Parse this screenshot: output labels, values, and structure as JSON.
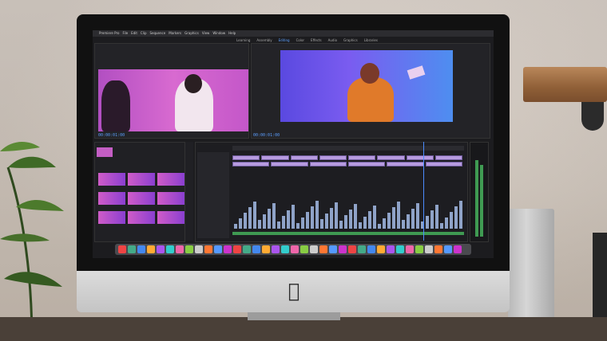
{
  "menubar": {
    "items": [
      "Premiere Pro",
      "File",
      "Edit",
      "Clip",
      "Sequence",
      "Markers",
      "Graphics",
      "View",
      "Window",
      "Help"
    ]
  },
  "workspaces": [
    "Learning",
    "Assembly",
    "Editing",
    "Color",
    "Effects",
    "Audio",
    "Graphics",
    "Libraries"
  ],
  "source_monitor": {
    "timecode": "00:00:01:00"
  },
  "program_monitor": {
    "timecode": "00:00:01:00"
  },
  "colors": {
    "source_video": "#c457c9",
    "program_video": "#6a5af0",
    "timeline_clip": "#b79be0",
    "playhead": "#4b8cff"
  }
}
